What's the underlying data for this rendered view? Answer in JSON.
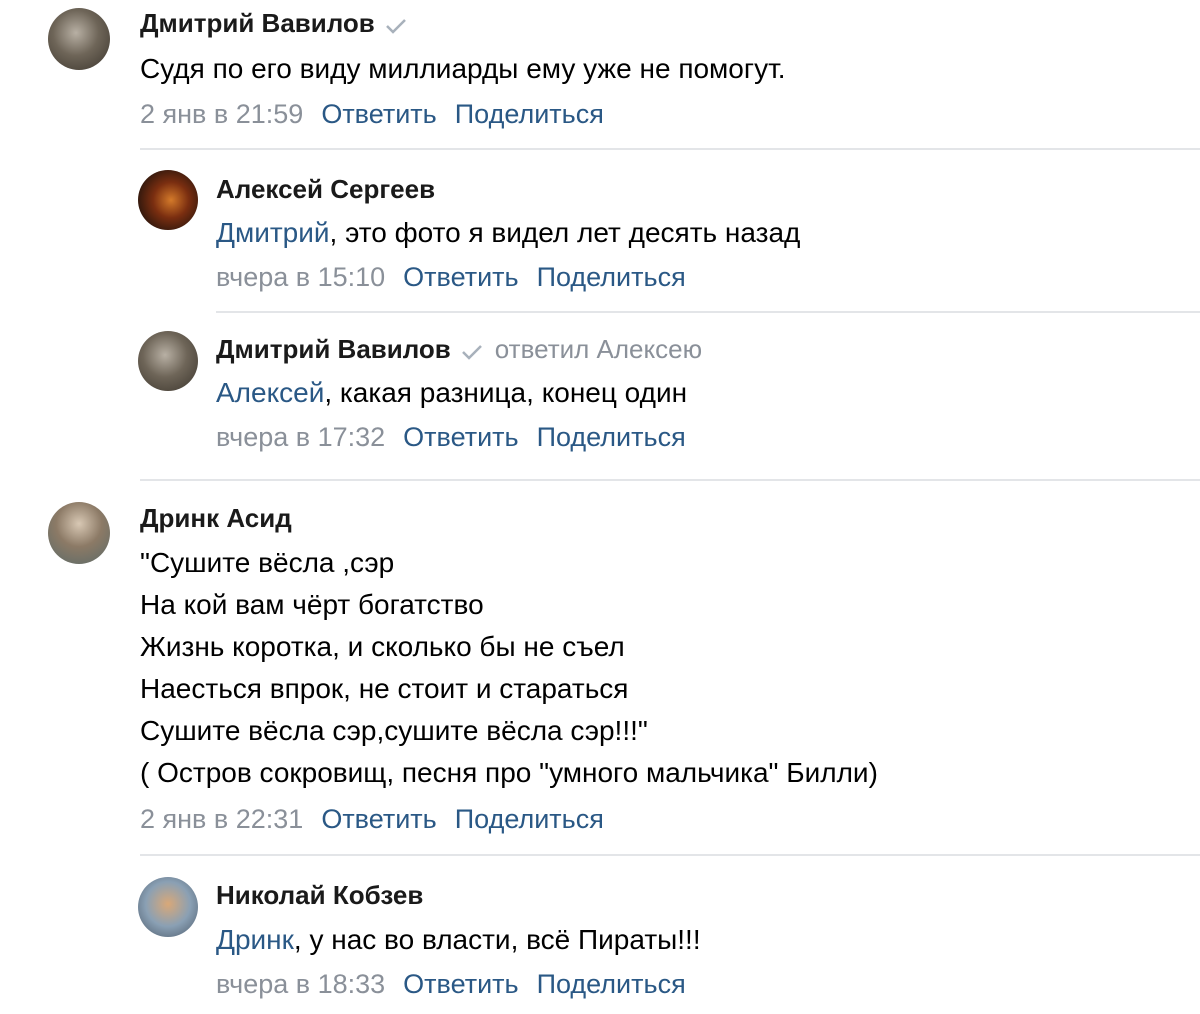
{
  "comments": [
    {
      "author": "Дмитрий Вавилов",
      "text": [
        "Судя по его виду миллиарды ему уже не помогут."
      ],
      "date": "2 янв в 21:59",
      "reply": "Ответить",
      "share": "Поделиться"
    },
    {
      "author": "Алексей Сергеев",
      "mention": "Дмитрий",
      "text_rest": ", это фото я видел лет десять назад",
      "date": "вчера в 15:10",
      "reply": "Ответить",
      "share": "Поделиться"
    },
    {
      "author": "Дмитрий Вавилов",
      "reply_to": "ответил Алексею",
      "mention": "Алексей",
      "text_rest": ", какая разница, конец один",
      "date": "вчера в 17:32",
      "reply": "Ответить",
      "share": "Поделиться"
    },
    {
      "author": "Дринк Асид",
      "text": [
        "\"Сушите вёсла ,сэр",
        "На кой вам чёрт богатство",
        "Жизнь коротка, и сколько бы не съел",
        "Наесться впрок, не стоит и стараться",
        "Сушите вёсла сэр,сушите вёсла сэр!!!\"",
        "( Остров сокровищ, песня про \"умного мальчика\" Билли)"
      ],
      "date": "2 янв в 22:31",
      "reply": "Ответить",
      "share": "Поделиться"
    },
    {
      "author": "Николай Кобзев",
      "mention": "Дринк",
      "text_rest": ", у нас во власти, всё Пираты!!!",
      "date": "вчера в 18:33",
      "reply": "Ответить",
      "share": "Поделиться"
    }
  ],
  "colors": {
    "link": "#2a5885",
    "meta": "#8a9099",
    "divider": "#e3e5e8"
  },
  "icons": [
    "verified-check-icon"
  ]
}
